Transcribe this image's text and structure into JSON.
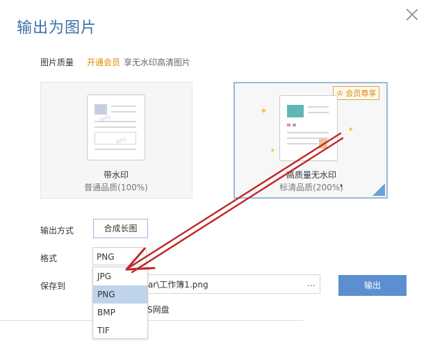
{
  "dialog": {
    "title": "输出为图片",
    "close_icon": "close-icon"
  },
  "quality": {
    "label": "图片质量",
    "vip_link": "开通会员",
    "vip_desc": "享无水印高清图片",
    "options": [
      {
        "title": "带水印",
        "subtitle": "普通品质(100%)",
        "selected": false
      },
      {
        "title": "高质量无水印",
        "subtitle": "标清品质(200%)",
        "selected": true,
        "badge": "会员尊享",
        "badge_icon": "crown-icon"
      }
    ]
  },
  "output_method": {
    "label": "输出方式",
    "value": "合成长图"
  },
  "format": {
    "label": "格式",
    "value": "PNG",
    "options": [
      "JPG",
      "PNG",
      "BMP",
      "TIF"
    ],
    "highlighted": "PNG"
  },
  "save_to": {
    "label": "保存到",
    "path": "star\\工作簿1.png",
    "browse": "...",
    "cloud_option": "S网盘"
  },
  "export_button": "输出",
  "colors": {
    "title": "#3e6fa8",
    "accent": "#5b8fd0",
    "vip": "#e08a00",
    "arrow": "#c0282a"
  }
}
